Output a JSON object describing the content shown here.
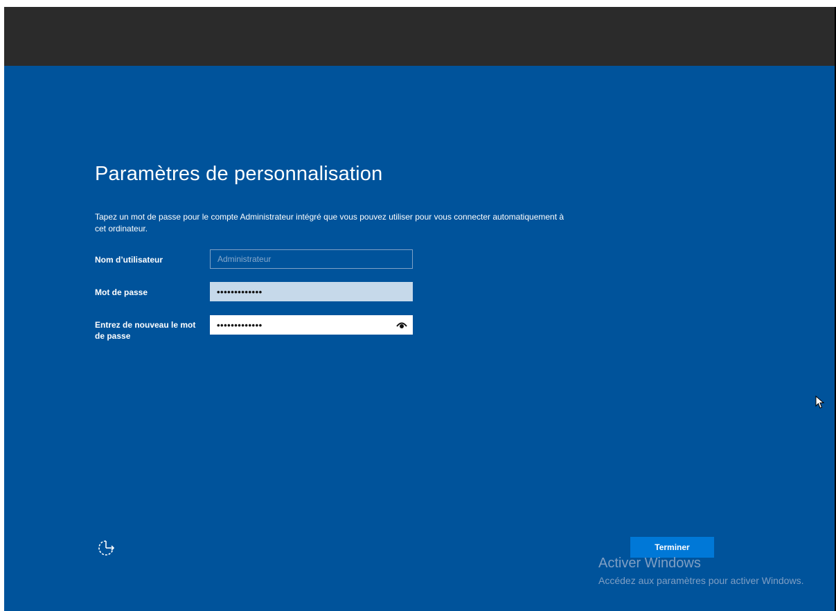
{
  "page": {
    "title": "Paramètres de personnalisation",
    "description": "Tapez un mot de passe pour le compte Administrateur intégré que vous pouvez utiliser pour vous connecter automatiquement à cet ordinateur."
  },
  "form": {
    "username": {
      "label": "Nom d’utilisateur",
      "value": "Administrateur"
    },
    "password": {
      "label": "Mot de passe",
      "masked_value": "•••••••••••••"
    },
    "confirm": {
      "label": "Entrez de nouveau le mot de passe",
      "masked_value": "•••••••••••••",
      "reveal_icon": "eye-icon"
    }
  },
  "footer": {
    "accessibility_icon": "ease-of-access-icon",
    "finish_label": "Terminer"
  },
  "watermark": {
    "title": "Activer Windows",
    "text": "Accédez aux paramètres pour activer Windows."
  },
  "colors": {
    "background": "#00539b",
    "top_bar": "#2b2b2b",
    "button": "#0078d7",
    "watermark": "#7f9fc4"
  }
}
